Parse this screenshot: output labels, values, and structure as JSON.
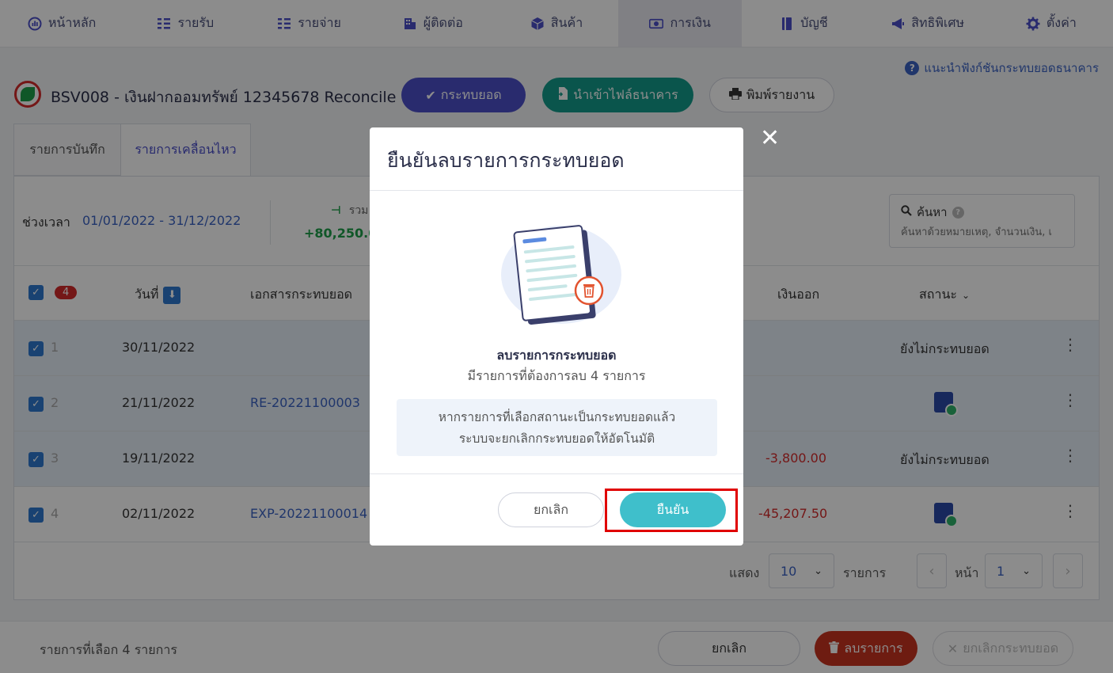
{
  "nav": {
    "items": [
      {
        "label": "หน้าหลัก",
        "icon": "dashboard-icon"
      },
      {
        "label": "รายรับ",
        "icon": "income-list-icon"
      },
      {
        "label": "รายจ่าย",
        "icon": "expense-list-icon"
      },
      {
        "label": "ผู้ติดต่อ",
        "icon": "contacts-building-icon"
      },
      {
        "label": "สินค้า",
        "icon": "product-box-icon"
      },
      {
        "label": "การเงิน",
        "icon": "money-icon"
      },
      {
        "label": "บัญชี",
        "icon": "account-book-icon"
      },
      {
        "label": "สิทธิพิเศษ",
        "icon": "megaphone-icon"
      },
      {
        "label": "ตั้งค่า",
        "icon": "gear-icon"
      }
    ],
    "active_index": 5
  },
  "help_link": "แนะนำฟังก์ชันกระทบยอดธนาคาร",
  "account": {
    "title": "BSV008 - เงินฝากออมทรัพย์ 12345678 Reconcile",
    "reconcile_label": "กระทบยอด",
    "import_label": "นำเข้าไฟล์ธนาคาร",
    "print_label": "พิมพ์รายงาน"
  },
  "tabs": {
    "records": "รายการบันทึก",
    "movements": "รายการเคลื่อนไหว"
  },
  "filter": {
    "period_label": "ช่วงเวลา",
    "period_value": "01/01/2022 - 31/12/2022",
    "summary_label": "รวม",
    "summary_value": "+80,250.0"
  },
  "search": {
    "title": "ค้นหา",
    "placeholder": "ค้นหาด้วยหมายเหตุ, จำนวนเงิน, เ"
  },
  "table": {
    "selected_count": "4",
    "headers": {
      "date": "วันที่",
      "doc": "เอกสารกระทบยอด",
      "out": "เงินออก",
      "status": "สถานะ"
    },
    "rows": [
      {
        "num": "1",
        "date": "30/11/2022",
        "doc": "",
        "out": "",
        "status": "ยังไม่กระทบยอด",
        "status_icon": false,
        "selected": true
      },
      {
        "num": "2",
        "date": "21/11/2022",
        "doc": "RE-20221100003",
        "out": "",
        "status": "",
        "status_icon": true,
        "selected": true
      },
      {
        "num": "3",
        "date": "19/11/2022",
        "doc": "",
        "out": "-3,800.00",
        "status": "ยังไม่กระทบยอด",
        "status_icon": false,
        "selected": true
      },
      {
        "num": "4",
        "date": "02/11/2022",
        "doc": "EXP-20221100014",
        "out": "-45,207.50",
        "status": "",
        "status_icon": true,
        "selected": false
      }
    ]
  },
  "pagination": {
    "show_label": "แสดง",
    "page_size": "10",
    "items_label": "รายการ",
    "page_label": "หน้า",
    "page": "1"
  },
  "footer": {
    "selected_text": "รายการที่เลือก 4 รายการ",
    "cancel_label": "ยกเลิก",
    "delete_label": "ลบรายการ",
    "unreconcile_label": "ยกเลิกกระทบยอด"
  },
  "modal": {
    "title": "ยืนยันลบรายการกระทบยอด",
    "subtitle": "ลบรายการกระทบยอด",
    "description": "มีรายการที่ต้องการลบ 4 รายการ",
    "info_line1": "หากรายการที่เลือกสถานะเป็นกระทบยอดแล้ว",
    "info_line2": "ระบบจะยกเลิกกระทบยอดให้อัตโนมัติ",
    "cancel_label": "ยกเลิก",
    "confirm_label": "ยืนยัน"
  },
  "colors": {
    "primary": "#4b4fc9",
    "teal": "#139b8a",
    "confirm": "#3fbfcb",
    "danger": "#c8341f",
    "highlight": "#e00000"
  }
}
